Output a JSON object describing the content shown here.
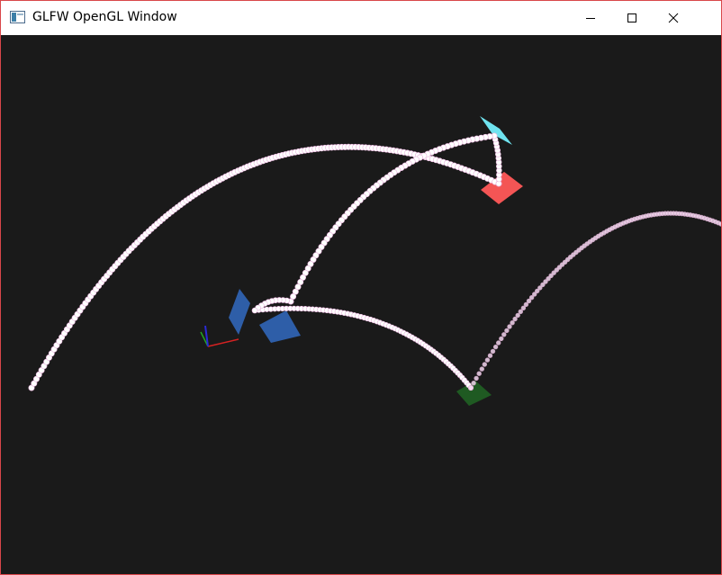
{
  "window": {
    "title": "GLFW OpenGL Window",
    "icon": "glfw-app-icon",
    "controls": {
      "minimize_icon": "minimize-icon",
      "maximize_icon": "maximize-icon",
      "close_icon": "close-icon"
    },
    "border_color": "#d9474a"
  },
  "scene": {
    "background_color": "#1a1a1a",
    "particle_color": "#ffffff",
    "particle_trail_tint": "#e8b4dc",
    "objects": [
      {
        "name": "cyan-plane",
        "color": "#6fe3ef"
      },
      {
        "name": "red-plane",
        "color": "#f45555"
      },
      {
        "name": "blue-plane",
        "color": "#2e5ea8"
      },
      {
        "name": "green-plane",
        "color": "#1f5a22"
      },
      {
        "name": "axes-gizmo",
        "colors": [
          "#d62222",
          "#22a822",
          "#2a2ad6"
        ]
      }
    ]
  }
}
